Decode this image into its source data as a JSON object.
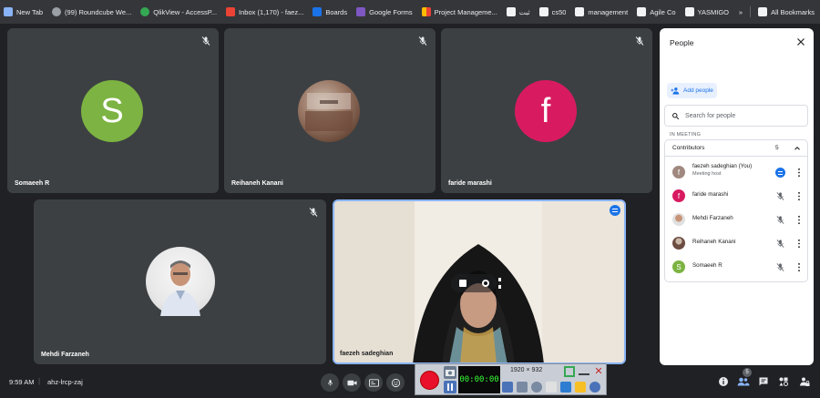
{
  "bookmarks": [
    {
      "label": "New Tab",
      "icon": "new-tab-icon",
      "color": "#8ab4f8"
    },
    {
      "label": "(99) Roundcube We...",
      "icon": "roundcube-icon",
      "color": "#9aa0a6"
    },
    {
      "label": "QlikView - AccessP...",
      "icon": "qlikview-icon",
      "color": "#34a853"
    },
    {
      "label": "Inbox (1,170) - faez...",
      "icon": "gmail-icon",
      "color": "#ea4335"
    },
    {
      "label": "Boards",
      "icon": "trello-icon",
      "color": "#1a73e8"
    },
    {
      "label": "Google Forms",
      "icon": "google-forms-icon",
      "color": "#7e57c2"
    },
    {
      "label": "Project Manageme...",
      "icon": "project-icon",
      "color": "#fbbc04"
    },
    {
      "label": "ثبت",
      "icon": "folder-icon",
      "color": "#f1f3f4"
    },
    {
      "label": "cs50",
      "icon": "folder-icon",
      "color": "#f1f3f4"
    },
    {
      "label": "management",
      "icon": "folder-icon",
      "color": "#f1f3f4"
    },
    {
      "label": "Agile Co",
      "icon": "folder-icon",
      "color": "#f1f3f4"
    },
    {
      "label": "YASMIGO",
      "icon": "folder-icon",
      "color": "#f1f3f4"
    }
  ],
  "bookmarks_overflow": "»",
  "all_bookmarks": "All Bookmarks",
  "tiles": [
    {
      "name": "Somaeeh R",
      "initial": "S",
      "color": "#7cb342"
    },
    {
      "name": "Reihaneh Kanani",
      "initial": "",
      "color": "#8d6e63"
    },
    {
      "name": "faride marashi",
      "initial": "f",
      "color": "#d81b60"
    },
    {
      "name": "Mehdi Farzaneh",
      "initial": "",
      "color": "#e0e0e0"
    },
    {
      "name": "faezeh sadeghian",
      "initial": "",
      "color": "#f5f1ea"
    }
  ],
  "panel": {
    "title": "People",
    "add_people": "Add people",
    "search_placeholder": "Search for people",
    "section_label": "IN MEETING",
    "group_label": "Contributors",
    "group_count": "5",
    "people": [
      {
        "name": "faezeh sadeghian (You)",
        "sub": "Meeting host",
        "initial": "f",
        "color": "#a1887f",
        "speaking": true
      },
      {
        "name": "faride marashi",
        "sub": "",
        "initial": "f",
        "color": "#d81b60",
        "speaking": false
      },
      {
        "name": "Mehdi Farzaneh",
        "sub": "",
        "initial": "",
        "color": "#bdbdbd",
        "speaking": false
      },
      {
        "name": "Reihaneh Kanani",
        "sub": "",
        "initial": "",
        "color": "#6d4c41",
        "speaking": false
      },
      {
        "name": "Somaeeh R",
        "sub": "",
        "initial": "S",
        "color": "#7cb342",
        "speaking": false
      }
    ]
  },
  "bottom": {
    "time": "9:59 AM",
    "separator": "|",
    "meeting_code": "ahz-lrcp-zaj",
    "participants_badge": "5"
  },
  "recorder": {
    "timer": "00:00:00",
    "resolution": "1920 × 932",
    "record_color": "#e8102a"
  }
}
